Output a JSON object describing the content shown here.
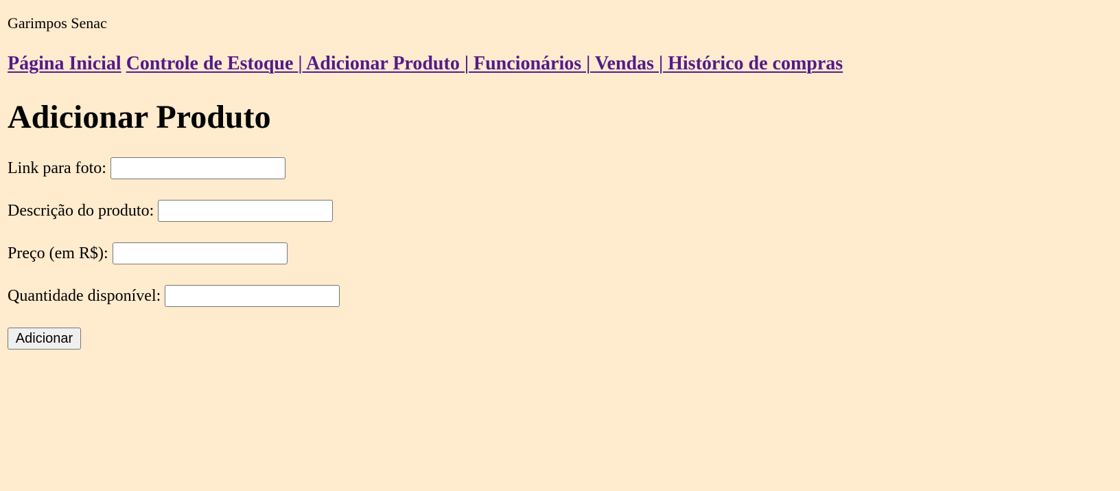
{
  "site": {
    "brand": "Garimpos Senac"
  },
  "nav": {
    "items": [
      {
        "label": "Página Inicial"
      },
      {
        "label": "Controle de Estoque"
      },
      {
        "label": "Adicionar Produto"
      },
      {
        "label": "Funcionários"
      },
      {
        "label": "Vendas"
      },
      {
        "label": "Histórico de compras"
      }
    ],
    "separator": " | "
  },
  "page": {
    "title": "Adicionar Produto"
  },
  "form": {
    "foto": {
      "label": "Link para foto:",
      "value": ""
    },
    "descricao": {
      "label": "Descrição do produto:",
      "value": ""
    },
    "preco": {
      "label": "Preço (em R$):",
      "value": ""
    },
    "quantidade": {
      "label": "Quantidade disponível:",
      "value": ""
    },
    "submit_label": "Adicionar"
  },
  "colors": {
    "background": "#ffebcd",
    "link_visited": "#551a8b"
  }
}
